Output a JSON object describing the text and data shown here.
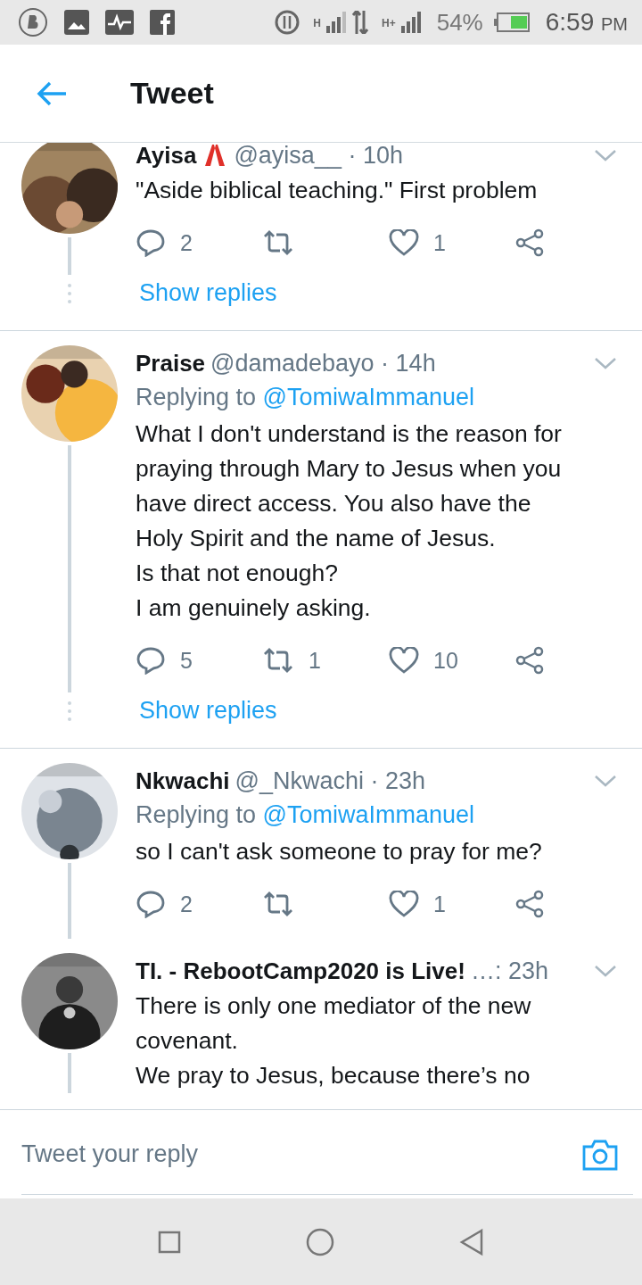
{
  "status_bar": {
    "network_1": "H",
    "network_2": "H+",
    "battery": "54%",
    "time": "6:59",
    "ampm": "PM"
  },
  "header": {
    "title": "Tweet"
  },
  "tweets": [
    {
      "name": "Ayisa",
      "badge": true,
      "meta": "@ayisa__ · 10h",
      "body": "\"Aside biblical teaching.\" First problem",
      "replies": "2",
      "likes": "1",
      "show_replies": "Show replies"
    },
    {
      "name": "Praise",
      "meta": "@damadebayo · 14h",
      "replying_label": "Replying to",
      "replying_to": "@TomiwaImmanuel",
      "body": "What I don't understand is the reason for\npraying through Mary to Jesus when you\nhave direct access. You also have the\nHoly Spirit and the name of Jesus.\nIs that not enough?\nI am genuinely asking.",
      "replies": "5",
      "retweets": "1",
      "likes": "10",
      "show_replies": "Show replies"
    },
    {
      "name": "Nkwachi",
      "meta": "@_Nkwachi · 23h",
      "replying_label": "Replying to",
      "replying_to": "@TomiwaImmanuel",
      "body": "so I can't ask someone to pray for me?",
      "replies": "2",
      "likes": "1"
    },
    {
      "name": "TI. - RebootCamp2020 is Live!",
      "meta": "…: 23h",
      "body": "There is only one mediator of the new\ncovenant.\nWe pray to Jesus, because there’s no"
    }
  ],
  "reply_bar": {
    "placeholder": "Tweet your reply"
  }
}
